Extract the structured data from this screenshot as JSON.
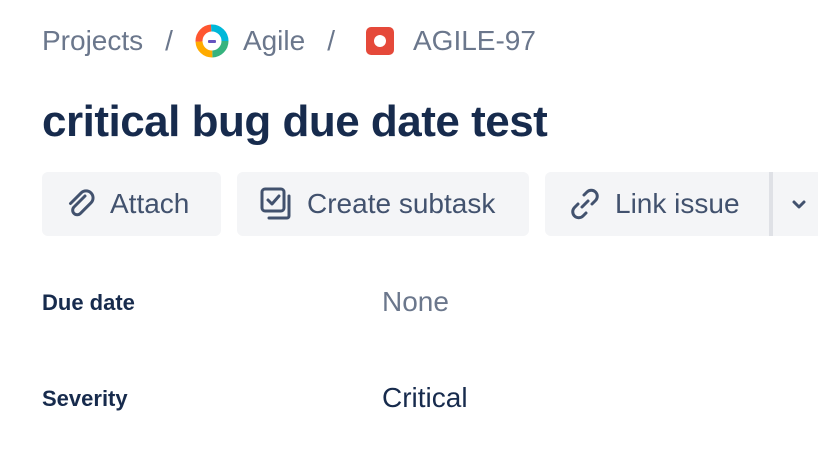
{
  "breadcrumb": {
    "projects": "Projects",
    "separator": "/",
    "project": "Agile",
    "issue_key": "AGILE-97"
  },
  "issue": {
    "title": "critical bug due date test"
  },
  "toolbar": {
    "attach_label": "Attach",
    "create_subtask_label": "Create subtask",
    "link_issue_label": "Link issue"
  },
  "fields": {
    "due_date": {
      "label": "Due date",
      "value": "None"
    },
    "severity": {
      "label": "Severity",
      "value": "Critical"
    }
  },
  "icons": {
    "project": "agile-project-avatar-icon",
    "issue_type": "bug-icon",
    "attach": "paperclip-icon",
    "subtask": "subtask-icon",
    "link": "link-icon",
    "more": "chevron-down-icon"
  },
  "colors": {
    "text_primary": "#172b4d",
    "text_subtle": "#6b778c",
    "button_bg": "#f4f5f7",
    "bug_red": "#e5493a"
  }
}
